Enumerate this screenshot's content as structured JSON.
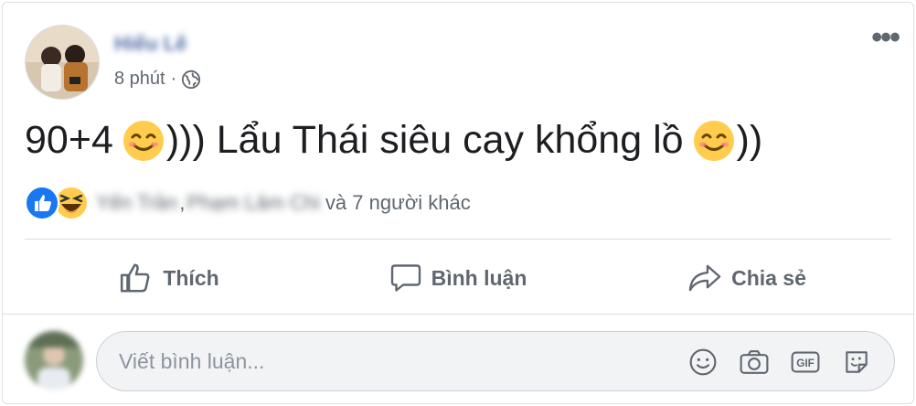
{
  "post": {
    "author_name": "Hiếu Lê",
    "timestamp": "8 phút",
    "separator": "·",
    "text_part1": "90+4",
    "text_part2": "))) Lẩu Thái siêu cay khổng lồ",
    "text_part3": "))",
    "emoji": "smiling-face-with-smiling-eyes"
  },
  "reactions": {
    "name1": "Yến Trần",
    "comma": ",",
    "name2": "Phạm Lâm Chi",
    "others": "và 7 người khác",
    "types": [
      "like",
      "haha"
    ]
  },
  "actions": {
    "like_label": "Thích",
    "comment_label": "Bình luận",
    "share_label": "Chia sẻ"
  },
  "comment": {
    "placeholder": "Viết bình luận...",
    "icons": [
      "emoji-icon",
      "camera-icon",
      "gif-icon",
      "sticker-icon"
    ]
  },
  "colors": {
    "accent": "#1877f2",
    "text_secondary": "#606770",
    "divider": "#dadde1",
    "input_bg": "#f2f3f5"
  }
}
